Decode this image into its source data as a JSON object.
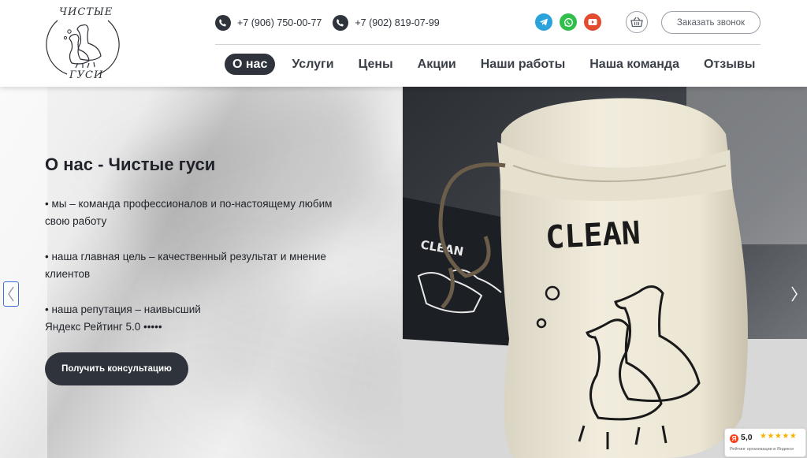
{
  "logo": {
    "top_text": "ЧИСТЫЕ",
    "bottom_text": "ГУСИ"
  },
  "header": {
    "phones": [
      "+7 (906) 750-00-77",
      "+7 (902) 819-07-99"
    ],
    "socials": [
      "telegram-icon",
      "whatsapp-icon",
      "youtube-icon"
    ],
    "callback_label": "Заказать звонок"
  },
  "nav": {
    "items": [
      "О нас",
      "Услуги",
      "Цены",
      "Акции",
      "Наши работы",
      "Наша команда",
      "Отзывы"
    ],
    "active_index": 0
  },
  "hero": {
    "title": "О нас - Чистые гуси",
    "bullets": [
      "• мы – команда профессионалов и по-настоящему любим свою работу",
      "• наша главная цель – качественный результат и мнение клиентов",
      "• наша репутация – наивысший"
    ],
    "rating_line": "Яндекс Рейтинг 5.0 •••••",
    "cta_label": "Получить консультацию",
    "bag_text": "CLEAN",
    "tag_text": "CLEAN"
  },
  "yandex_badge": {
    "score": "5,0",
    "stars": "★★★★★",
    "caption": "Рейтинг организации в Яндексе"
  },
  "colors": {
    "dark": "#2f343c",
    "telegram": "#2aa3dd",
    "whatsapp": "#2fbf4a",
    "youtube": "#e34a2e"
  }
}
